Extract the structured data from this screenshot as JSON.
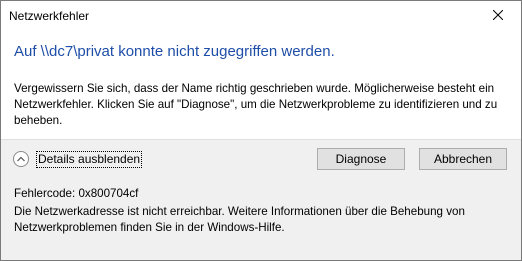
{
  "window": {
    "title": "Netzwerkfehler",
    "close_icon": "close-icon"
  },
  "main": {
    "heading": "Auf \\\\dc7\\privat konnte nicht zugegriffen werden.",
    "message": "Vergewissern Sie sich, dass der Name richtig geschrieben wurde. Möglicherweise besteht ein Netzwerkfehler. Klicken Sie auf \"Diagnose\", um die Netzwerkprobleme zu identifizieren und zu beheben."
  },
  "buttons": {
    "details_toggle_label": "Details ausblenden",
    "details_toggle_icon": "chevron-up-icon",
    "diagnose_label": "Diagnose",
    "cancel_label": "Abbrechen"
  },
  "details": {
    "error_code": "Fehlercode: 0x800704cf",
    "description": "Die Netzwerkadresse ist nicht erreichbar. Weitere Informationen über die Behebung von Netzwerkproblemen finden Sie in der Windows-Hilfe."
  },
  "colors": {
    "heading": "#1f4ea8",
    "footer_background": "#f0f0f0",
    "button_background": "#e1e1e1",
    "button_border": "#adadad"
  }
}
